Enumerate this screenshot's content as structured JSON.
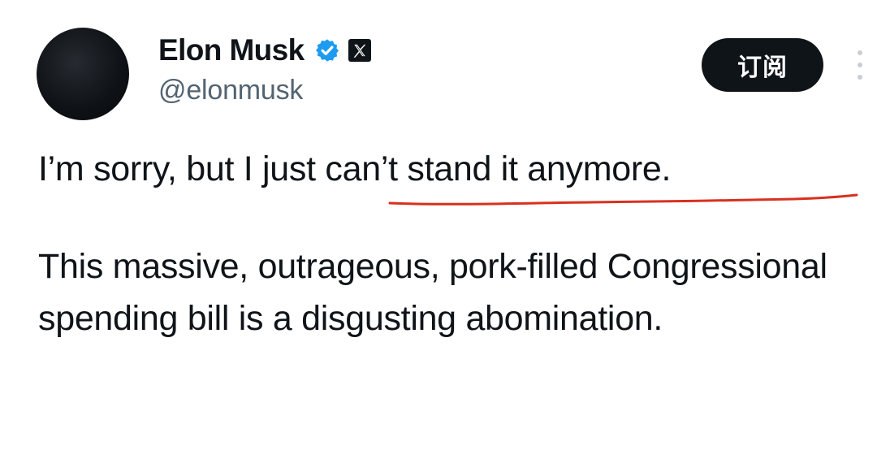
{
  "tweet": {
    "author": {
      "display_name": "Elon Musk",
      "handle": "@elonmusk",
      "avatar_color": "#0f1216",
      "verified_icon": "verified-badge-icon",
      "verified_color": "#1d9bf0",
      "affiliate_icon": "x-logo-icon"
    },
    "subscribe_label": "订阅",
    "more_icon": "vertical-ellipsis-icon",
    "paragraphs": [
      "I’m sorry, but I just can’t stand it anymore.",
      "This massive, outrageous, pork-filled Congressional spending bill is a disgusting abomination."
    ],
    "annotation": {
      "type": "red-underline",
      "highlighted_text": "can’t stand it anymore.",
      "color": "#d9301f"
    }
  }
}
